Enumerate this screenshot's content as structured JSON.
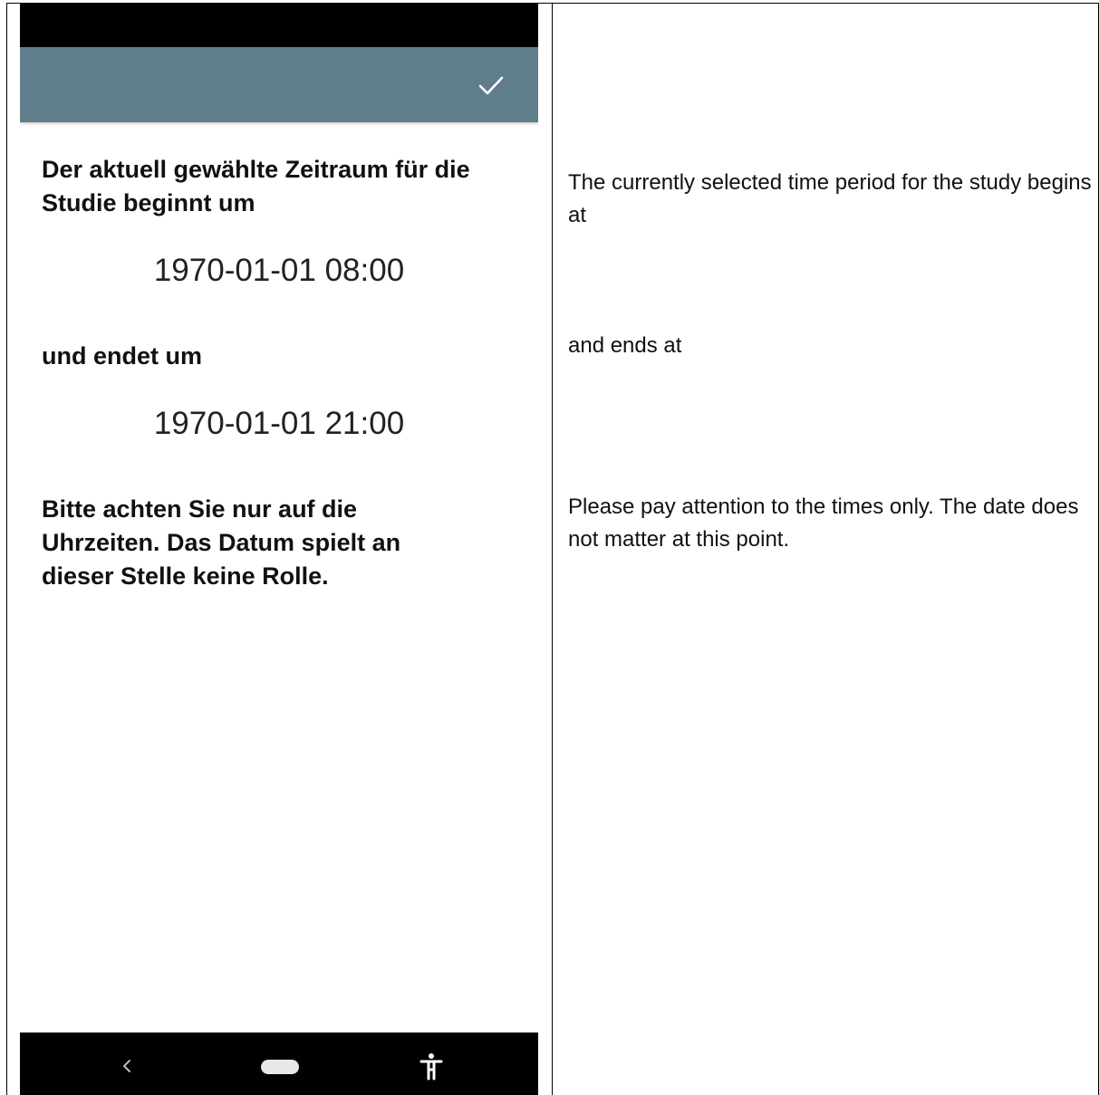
{
  "phone": {
    "app_bar": {
      "confirm_icon": "check-icon",
      "color": "#607d8b"
    },
    "content": {
      "start_heading": "Der aktuell gewählte Zeitraum für die Studie beginnt um",
      "start_datetime": "1970-01-01 08:00",
      "end_heading": "und endet um",
      "end_datetime": "1970-01-01 21:00",
      "notice": "Bitte achten Sie nur auf die Uhrzeiten. Das Datum spielt  an dieser Stelle keine Rolle."
    },
    "nav_bar": {
      "back_icon": "chevron-left-icon",
      "home_icon": "home-pill-icon",
      "accessibility_icon": "accessibility-icon"
    }
  },
  "translation": {
    "start": "The currently selected time period for the study begins at",
    "end": "and ends at",
    "notice": "Please pay attention to the times only. The date does not matter at this point."
  }
}
